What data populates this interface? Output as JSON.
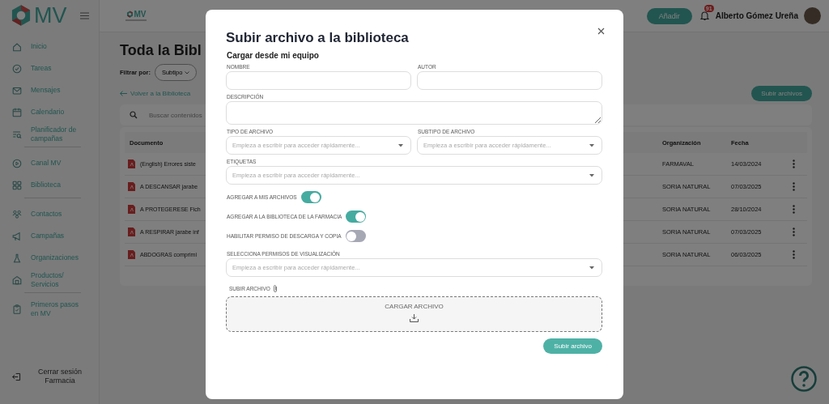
{
  "sidebar": {
    "logo_text": "MV",
    "groups": [
      [
        {
          "label": "Inicio"
        },
        {
          "label": "Tareas"
        },
        {
          "label": "Mensajes"
        },
        {
          "label": "Calendario"
        },
        {
          "label": "Planificador de campañas"
        }
      ],
      [
        {
          "label": "Canal MV"
        },
        {
          "label": "Biblioteca"
        }
      ],
      [
        {
          "label": "Contactos"
        },
        {
          "label": "Campañas"
        },
        {
          "label": "Organizaciones"
        },
        {
          "label": "Productos/ Servicios"
        }
      ],
      [
        {
          "label": "Primeros pasos en MV"
        }
      ]
    ],
    "logout": "Cerrar sesión Farmacia"
  },
  "topbar": {
    "org_logo_text": "MV",
    "add_button": "Añadir",
    "notification_count": "91",
    "user_name": "Alberto Gómez Ureña"
  },
  "page": {
    "title": "Toda la Bibl",
    "filter_label": "Filtrar por:",
    "filter_chip": "Subtipo",
    "back_link": "Volver a la Biblioteca",
    "upload_button": "Subir archivos",
    "search_placeholder": "Buscar contenidos",
    "table": {
      "columns": [
        "Documento",
        "Organización",
        "Fecha"
      ],
      "rows": [
        {
          "document": "(English) Errores siste",
          "organization": "FARMAVAL",
          "date": "14/03/2024"
        },
        {
          "document": "A DESCANSAR jarabe",
          "organization": "SORIA NATURAL",
          "date": "07/03/2025"
        },
        {
          "document": "A PROTEGERESE Fich",
          "organization": "SORIA NATURAL",
          "date": "28/10/2024"
        },
        {
          "document": "A RESPIRAR jarabe inf",
          "organization": "SORIA NATURAL",
          "date": "07/03/2025"
        },
        {
          "document": "ABDOGRAS comprimi",
          "organization": "SORIA NATURAL",
          "date": "06/03/2025"
        }
      ]
    }
  },
  "modal": {
    "title": "Subir archivo a la biblioteca",
    "subtitle": "Cargar desde mi equipo",
    "field_rows": [
      [
        {
          "kind": "text",
          "label": "NOMBRE"
        },
        {
          "kind": "text",
          "label": "AUTOR"
        }
      ],
      [
        {
          "kind": "textarea",
          "label": "DESCRIPCIÓN"
        }
      ],
      [
        {
          "kind": "select",
          "label": "TIPO DE ARCHIVO",
          "placeholder": "Empieza a escribir para acceder rápidamente..."
        },
        {
          "kind": "select",
          "label": "SUBTIPO DE ARCHIVO",
          "placeholder": "Empieza a escribir para acceder rápidamente..."
        }
      ],
      [
        {
          "kind": "select",
          "label": "ETIQUETAS",
          "placeholder": "Empieza a escribir para acceder rápidamente..."
        }
      ]
    ],
    "toggles": [
      {
        "label": "AGREGAR A MIS ARCHIVOS",
        "on": true
      },
      {
        "label": "AGREGAR A LA BIBLIOTECA DE LA FARMACIA",
        "on": true
      },
      {
        "label": "HABILITAR PERMISO DE DESCARGA Y COPIA",
        "on": false
      }
    ],
    "permissions": {
      "label": "SELECCIONA PERMISOS DE VISUALIZACIÓN",
      "placeholder": "Empieza a escribir para acceder rápidamente..."
    },
    "upload_label": "SUBIR ARCHIVO",
    "dropzone_label": "CARGAR ARCHIVO",
    "submit_button": "Subir archivo"
  }
}
